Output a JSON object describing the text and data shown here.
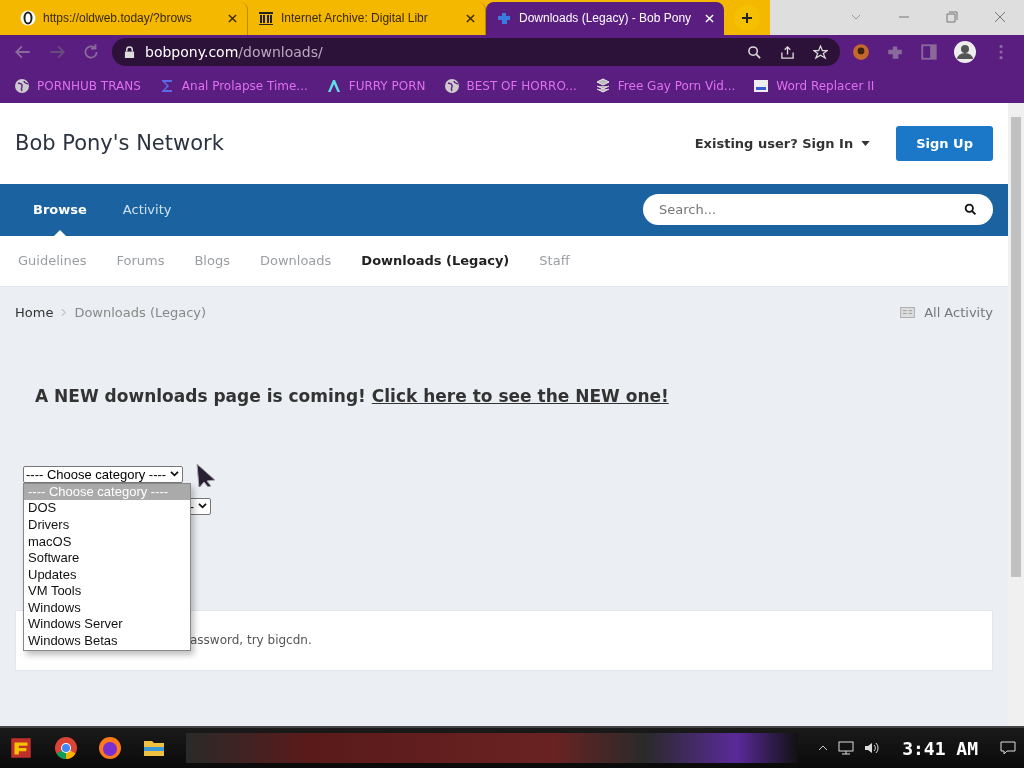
{
  "browser": {
    "tabs": [
      {
        "title": "https://oldweb.today/?brows",
        "selected": false
      },
      {
        "title": "Internet Archive: Digital Libr",
        "selected": false
      },
      {
        "title": "Downloads (Legacy) - Bob Pony",
        "selected": true
      }
    ],
    "address": {
      "domain": "bobpony.com",
      "path": "/downloads/"
    },
    "bookmarks": [
      {
        "label": "PORNHUB TRANS"
      },
      {
        "label": "Anal Prolapse Time..."
      },
      {
        "label": "FURRY PORN"
      },
      {
        "label": "BEST OF HORRO..."
      },
      {
        "label": "Free Gay Porn Vid..."
      },
      {
        "label": "Word Replacer II"
      }
    ]
  },
  "site": {
    "title": "Bob Pony's Network",
    "sign_in": "Existing user? Sign In",
    "sign_up": "Sign Up",
    "nav": [
      {
        "label": "Browse",
        "selected": true
      },
      {
        "label": "Activity",
        "selected": false
      }
    ],
    "search": {
      "placeholder": "Search..."
    },
    "subnav": [
      {
        "label": "Guidelines",
        "selected": false
      },
      {
        "label": "Forums",
        "selected": false
      },
      {
        "label": "Blogs",
        "selected": false
      },
      {
        "label": "Downloads",
        "selected": false
      },
      {
        "label": "Downloads (Legacy)",
        "selected": true
      },
      {
        "label": "Staff",
        "selected": false
      }
    ],
    "breadcrumb": [
      "Home",
      "Downloads (Legacy)"
    ],
    "all_activity": "All Activity",
    "announcement": {
      "text": "A NEW downloads page is coming! ",
      "link": "Click here to see the NEW one!"
    },
    "category_select": {
      "value": "---- Choose category ----",
      "options": [
        {
          "label": "---- Choose category ----",
          "selected": true
        },
        {
          "label": "DOS",
          "selected": false
        },
        {
          "label": "Drivers",
          "selected": false
        },
        {
          "label": "macOS",
          "selected": false
        },
        {
          "label": "Software",
          "selected": false
        },
        {
          "label": "Updates",
          "selected": false
        },
        {
          "label": "VM Tools",
          "selected": false
        },
        {
          "label": "Windows",
          "selected": false
        },
        {
          "label": "Windows Server",
          "selected": false
        },
        {
          "label": "Windows Betas",
          "selected": false
        }
      ]
    },
    "second_select": {
      "value": "-"
    },
    "note": "assword, try bigcdn."
  },
  "taskbar": {
    "time": "3:41 AM"
  }
}
